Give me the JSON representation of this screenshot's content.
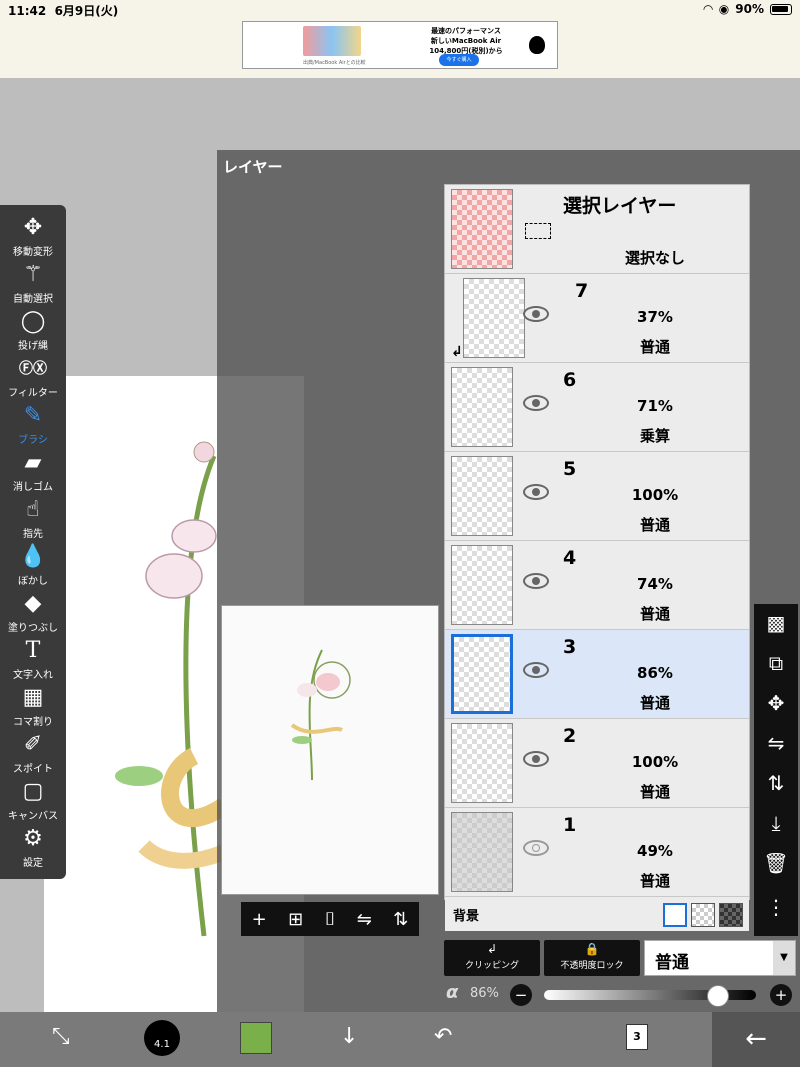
{
  "status": {
    "time": "11:42",
    "date": "6月9日(火)",
    "battery": "90%"
  },
  "ad": {
    "line1": "最速のパフォーマンス",
    "line2": "新しいMacBook Air",
    "line3": "104,800円(税別)から",
    "button": "今すぐ購入",
    "small": "出典/MacBook Airとの比較"
  },
  "tools": [
    {
      "label": "移動変形",
      "icon": "move-icon"
    },
    {
      "label": "自動選択",
      "icon": "magic-wand-icon"
    },
    {
      "label": "投げ縄",
      "icon": "lasso-icon"
    },
    {
      "label": "フィルター",
      "icon": "fx-icon"
    },
    {
      "label": "ブラシ",
      "icon": "brush-icon"
    },
    {
      "label": "消しゴム",
      "icon": "eraser-icon"
    },
    {
      "label": "指先",
      "icon": "finger-icon"
    },
    {
      "label": "ぼかし",
      "icon": "blur-icon"
    },
    {
      "label": "塗りつぶし",
      "icon": "fill-icon"
    },
    {
      "label": "文字入れ",
      "icon": "text-icon"
    },
    {
      "label": "コマ割り",
      "icon": "panel-icon"
    },
    {
      "label": "スポイト",
      "icon": "eyedropper-icon"
    },
    {
      "label": "キャンバス",
      "icon": "canvas-icon"
    },
    {
      "label": "設定",
      "icon": "gear-icon"
    }
  ],
  "active_tool": "ブラシ",
  "layer_panel": {
    "title": "レイヤー",
    "selection_layer": {
      "title": "選択レイヤー",
      "status": "選択なし"
    },
    "layers": [
      {
        "name": "7",
        "opacity": "37%",
        "mode": "普通",
        "visible": true,
        "clipping": true
      },
      {
        "name": "6",
        "opacity": "71%",
        "mode": "乗算",
        "visible": true
      },
      {
        "name": "5",
        "opacity": "100%",
        "mode": "普通",
        "visible": true
      },
      {
        "name": "4",
        "opacity": "74%",
        "mode": "普通",
        "visible": true
      },
      {
        "name": "3",
        "opacity": "86%",
        "mode": "普通",
        "visible": true,
        "selected": true
      },
      {
        "name": "2",
        "opacity": "100%",
        "mode": "普通",
        "visible": true
      },
      {
        "name": "1",
        "opacity": "49%",
        "mode": "普通",
        "visible": false
      }
    ],
    "background_label": "背景",
    "clipping_label": "クリッピング",
    "alpha_lock_label": "不透明度ロック",
    "blend_mode": "普通",
    "alpha_symbol": "α",
    "opacity_value": "86%",
    "opacity_fraction": 0.86
  },
  "bottom": {
    "brush_size": "4.1",
    "page_count": "3",
    "color": "#7ab04a"
  }
}
